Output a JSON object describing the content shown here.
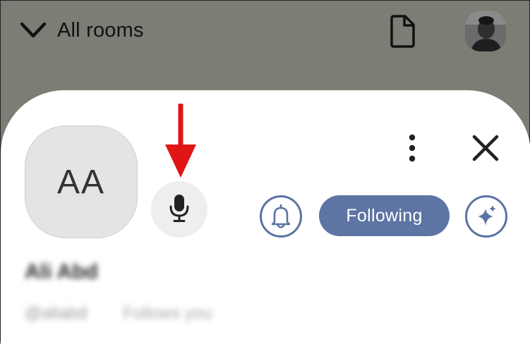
{
  "header": {
    "back_label": "All rooms",
    "icons": [
      "chevron-down-icon",
      "document-icon",
      "user-avatar"
    ]
  },
  "profile": {
    "initials": "AA",
    "display_name": "Ali Abd",
    "username": "@aliabd",
    "follows_status": "Follows you"
  },
  "actions": {
    "following_label": "Following",
    "icons": [
      "microphone-icon",
      "more-vertical-icon",
      "close-icon",
      "bell-icon",
      "sparkles-icon"
    ]
  },
  "annotation": {
    "arrow_color": "#e01515"
  },
  "colors": {
    "overlay": "#7d7c75",
    "sheet": "#ffffff",
    "accent": "#5d74a4",
    "mic_bg": "#eeeeee",
    "avatar_bg": "#e4e4e4"
  }
}
